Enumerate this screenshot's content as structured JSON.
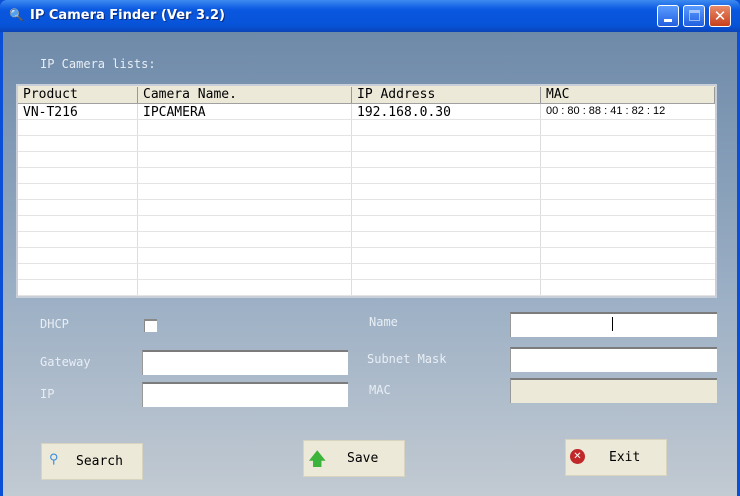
{
  "window": {
    "title": "IP Camera Finder (Ver 3.2)"
  },
  "list": {
    "label": "IP Camera lists:",
    "columns": [
      "Product",
      "Camera Name.",
      "IP Address",
      "MAC"
    ],
    "rows": [
      [
        "VN-T216",
        "IPCAMERA",
        "192.168.0.30",
        "00 : 80 : 88 : 41 : 82 : 12"
      ]
    ]
  },
  "form": {
    "dhcp": "DHCP",
    "gateway": "Gateway",
    "ip": "IP",
    "name": "Name",
    "subnet": "Subnet Mask",
    "mac": "MAC",
    "dhcp_checked": false
  },
  "buttons": {
    "search": "Search",
    "save": "Save",
    "exit": "Exit"
  }
}
